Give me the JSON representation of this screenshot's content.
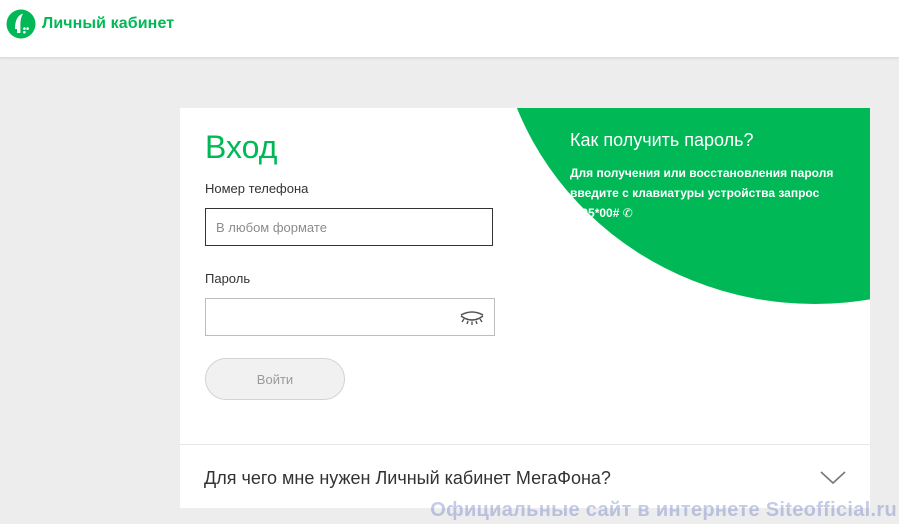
{
  "brand": {
    "name": "Личный кабинет",
    "color": "#00b956"
  },
  "login": {
    "title": "Вход",
    "phone_label": "Номер телефона",
    "phone_placeholder": "В любом формате",
    "phone_value": "",
    "password_label": "Пароль",
    "password_value": "",
    "password_toggle_icon": "eye-closed-icon",
    "submit_label": "Войти"
  },
  "help": {
    "title": "Как получить пароль?",
    "text": "Для получения или восстановления пароля введите с клавиатуры устройства запрос *105*00#",
    "call_icon": "phone-handset-icon",
    "call_glyph": "✆"
  },
  "faq": {
    "question": "Для чего мне нужен Личный кабинет МегаФона?",
    "icon": "chevron-down-icon"
  },
  "watermark": {
    "text": "Официальные сайт в интернете Siteofficial.ru"
  }
}
